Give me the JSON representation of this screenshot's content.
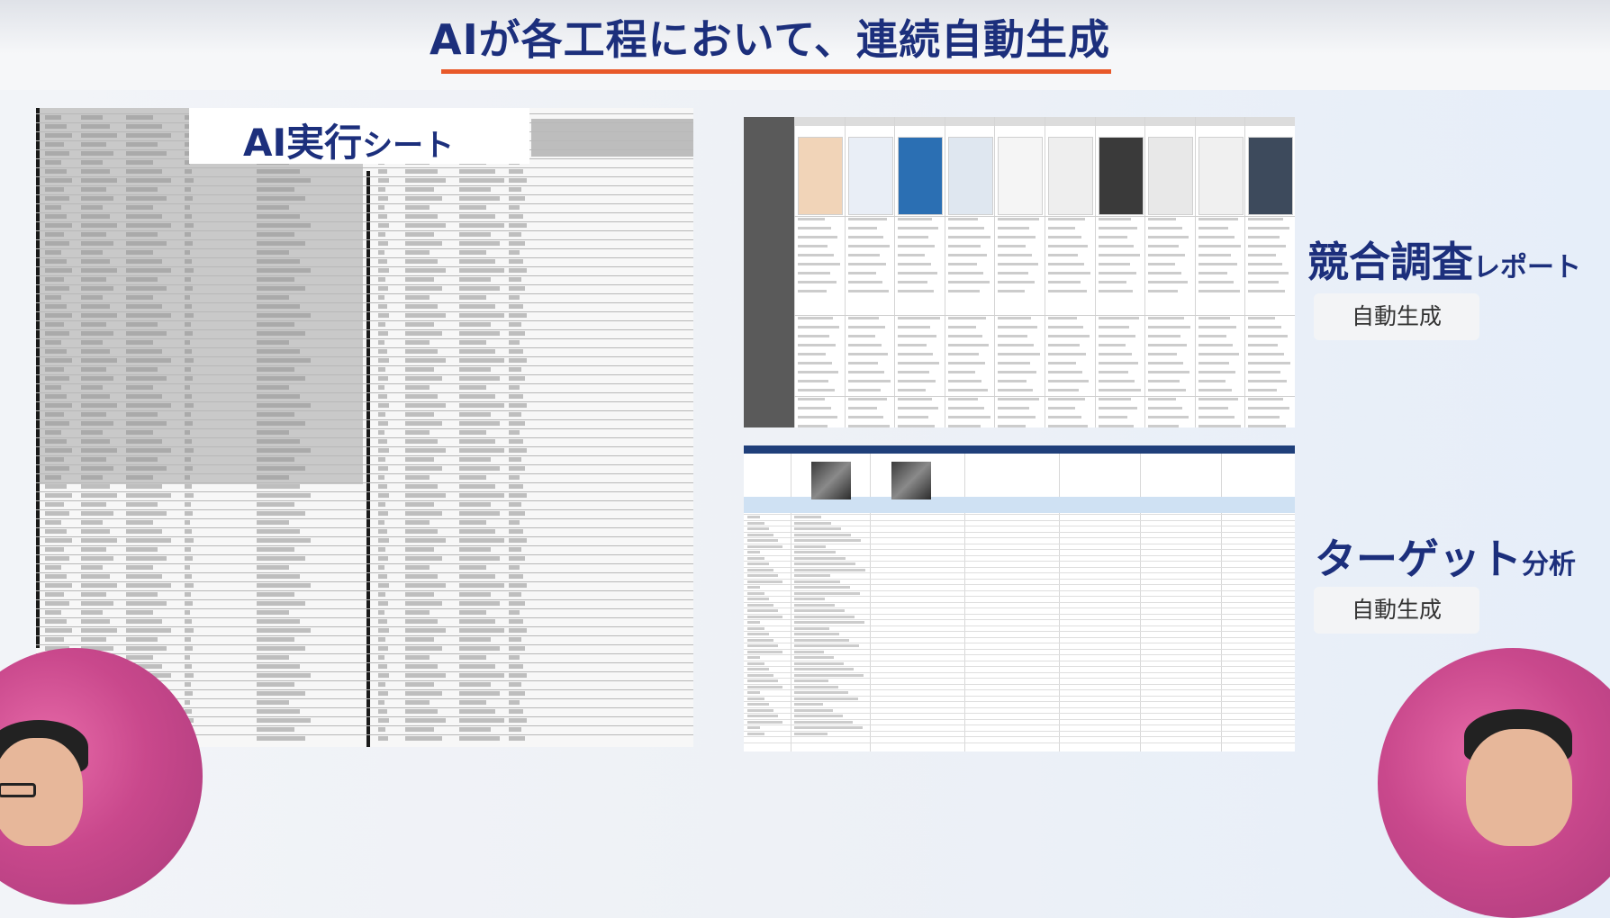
{
  "slide": {
    "title": "AIが各工程において、連続自動生成"
  },
  "sheet": {
    "label_main": "AI実行",
    "label_small": "シート"
  },
  "competitor": {
    "label_main": "競合調査",
    "label_small": "レポート",
    "badge": "自動生成"
  },
  "target": {
    "label_main": "ターゲット",
    "label_small": "分析",
    "badge": "自動生成"
  },
  "colors": {
    "title": "#1c2f7c",
    "underline": "#e8592a",
    "presenter_bg": "#c9488c"
  }
}
